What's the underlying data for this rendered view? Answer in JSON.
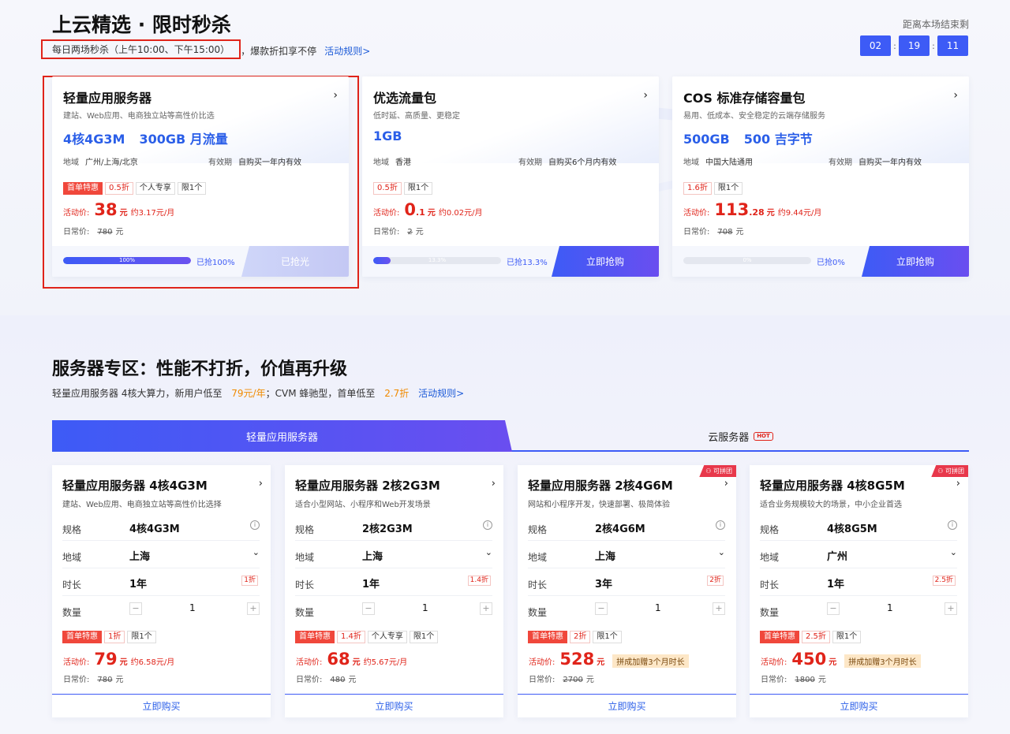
{
  "flash": {
    "title": "上云精选 · 限时秒杀",
    "sub_boxed": "每日两场秒杀（上午10:00、下午15:00）",
    "sub_rest": "，爆款折扣享不停",
    "rules_link": "活动规则>",
    "countdown_label": "距离本场结束剩",
    "countdown": {
      "h": "02",
      "m": "19",
      "s": "11"
    },
    "cards": [
      {
        "title": "轻量应用服务器",
        "desc": "建站、Web应用、电商独立站等高性价比选",
        "spec_a": "4核4G3M",
        "spec_b": "300GB 月流量",
        "region_k": "地域",
        "region_v": "广州/上海/北京",
        "valid_k": "有效期",
        "valid_v": "自购买一年内有效",
        "tags": [
          "首单特惠",
          "0.5折",
          "个人专享",
          "限1个"
        ],
        "price_label": "活动价:",
        "price_int": "38",
        "price_dec": "",
        "unit": "元",
        "monthly": "约3.17元/月",
        "daily_label": "日常价:",
        "daily": "780",
        "progress": 100,
        "progress_text": "100%",
        "grab": "已抢100%",
        "btn": "已抢光"
      },
      {
        "title": "优选流量包",
        "desc": "低时延、高质量、更稳定",
        "spec_a": "1GB",
        "spec_b": "",
        "region_k": "地域",
        "region_v": "香港",
        "valid_k": "有效期",
        "valid_v": "自购买6个月内有效",
        "tags": [
          "0.5折",
          "限1个"
        ],
        "price_label": "活动价:",
        "price_int": "0",
        "price_dec": ".1",
        "unit": "元",
        "monthly": "约0.02元/月",
        "daily_label": "日常价:",
        "daily": "2",
        "progress": 13.3,
        "progress_text": "13.3%",
        "grab": "已抢13.3%",
        "btn": "立即抢购"
      },
      {
        "title": "COS 标准存储容量包",
        "desc": "易用、低成本、安全稳定的云端存储服务",
        "spec_a": "500GB",
        "spec_b": "500 吉字节",
        "region_k": "地域",
        "region_v": "中国大陆通用",
        "valid_k": "有效期",
        "valid_v": "自购买一年内有效",
        "tags": [
          "1.6折",
          "限1个"
        ],
        "price_label": "活动价:",
        "price_int": "113",
        "price_dec": ".28",
        "unit": "元",
        "monthly": "约9.44元/月",
        "daily_label": "日常价:",
        "daily": "708",
        "progress": 0,
        "progress_text": "0%",
        "grab": "已抢0%",
        "btn": "立即抢购"
      }
    ]
  },
  "server": {
    "title": "服务器专区：性能不打折，价值再升级",
    "sub_a": "轻量应用服务器 4核大算力，新用户低至",
    "sub_price": "79元/年",
    "sub_b": "；CVM 蜂驰型，首单低至",
    "sub_disc": "2.7折",
    "rules_link": "活动规则>",
    "tabs": [
      "轻量应用服务器",
      "云服务器"
    ],
    "hot": "HOT",
    "labels": {
      "spec": "规格",
      "region": "地域",
      "duration": "时长",
      "qty": "数量",
      "buy": "立即购买",
      "group": "可拼团",
      "price_label": "活动价:",
      "daily_label": "日常价:",
      "unit": "元"
    },
    "cards": [
      {
        "title": "轻量应用服务器 4核4G3M",
        "desc": "建站、Web应用、电商独立站等高性价比选择",
        "spec": "4核4G3M",
        "region": "上海",
        "duration": "1年",
        "duration_disc": "1折",
        "qty": "1",
        "tags": [
          "首单特惠",
          "1折",
          "限1个"
        ],
        "price": "79",
        "monthly": "约6.58元/月",
        "gift": "",
        "daily": "780",
        "group": false
      },
      {
        "title": "轻量应用服务器 2核2G3M",
        "desc": "适合小型网站、小程序和Web开发场景",
        "spec": "2核2G3M",
        "region": "上海",
        "duration": "1年",
        "duration_disc": "1.4折",
        "qty": "1",
        "tags": [
          "首单特惠",
          "1.4折",
          "个人专享",
          "限1个"
        ],
        "price": "68",
        "monthly": "约5.67元/月",
        "gift": "",
        "daily": "480",
        "group": false
      },
      {
        "title": "轻量应用服务器 2核4G6M",
        "desc": "网站和小程序开发，快速部署、极简体验",
        "spec": "2核4G6M",
        "region": "上海",
        "duration": "3年",
        "duration_disc": "2折",
        "qty": "1",
        "tags": [
          "首单特惠",
          "2折",
          "限1个"
        ],
        "price": "528",
        "monthly": "",
        "gift": "拼成加赠3个月时长",
        "daily": "2700",
        "group": true
      },
      {
        "title": "轻量应用服务器 4核8G5M",
        "desc": "适合业务规模较大的场景，中小企业首选",
        "spec": "4核8G5M",
        "region": "广州",
        "duration": "1年",
        "duration_disc": "2.5折",
        "qty": "1",
        "tags": [
          "首单特惠",
          "2.5折",
          "限1个"
        ],
        "price": "450",
        "monthly": "",
        "gift": "拼成加赠3个月时长",
        "daily": "1800",
        "group": true
      }
    ]
  }
}
